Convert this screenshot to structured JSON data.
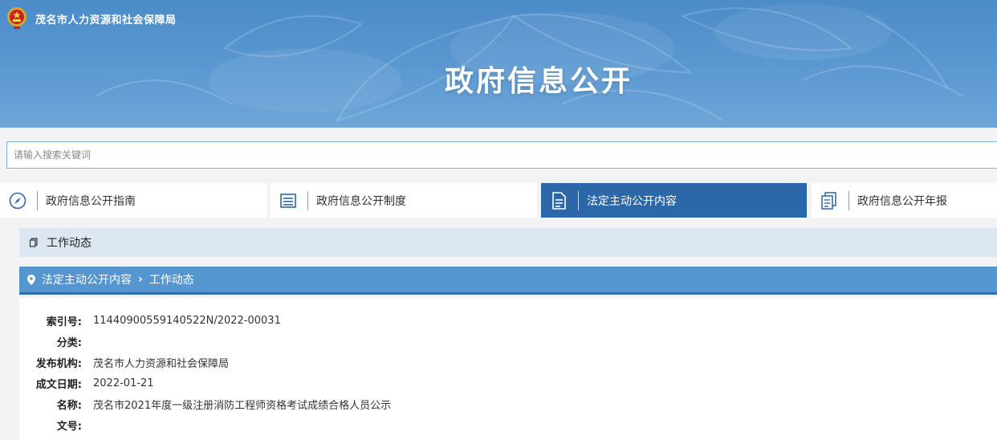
{
  "header": {
    "org_name": "茂名市人力资源和社会保障局",
    "banner_title": "政府信息公开"
  },
  "search": {
    "placeholder": "请输入搜索关键词",
    "value": ""
  },
  "tabs": [
    {
      "label": "政府信息公开指南",
      "icon": "compass-icon",
      "active": false
    },
    {
      "label": "政府信息公开制度",
      "icon": "list-icon",
      "active": false
    },
    {
      "label": "法定主动公开内容",
      "icon": "document-icon",
      "active": true
    },
    {
      "label": "政府信息公开年报",
      "icon": "report-icon",
      "active": false
    }
  ],
  "section": {
    "title": "工作动态",
    "icon": "copy-icon"
  },
  "breadcrumb": {
    "icon": "location-pin-icon",
    "items": [
      "法定主动公开内容",
      "工作动态"
    ],
    "separator_icon": "chevron-right-icon"
  },
  "meta": {
    "index_label": "索引号:",
    "index_value": "11440900559140522N/2022-00031",
    "category_label": "分类:",
    "category_value": "",
    "publisher_label": "发布机构:",
    "publisher_value": "茂名市人力资源和社会保障局",
    "date_label": "成文日期:",
    "date_value": "2022-01-21",
    "name_label": "名称:",
    "name_value": "茂名市2021年度一级注册消防工程师资格考试成绩合格人员公示",
    "docno_label": "文号:",
    "docno_value": ""
  },
  "colors": {
    "banner": "#5c99d2",
    "active_tab": "#2c67a9",
    "breadcrumb_bar": "#5595d0",
    "section_bar": "#dde7f1"
  }
}
